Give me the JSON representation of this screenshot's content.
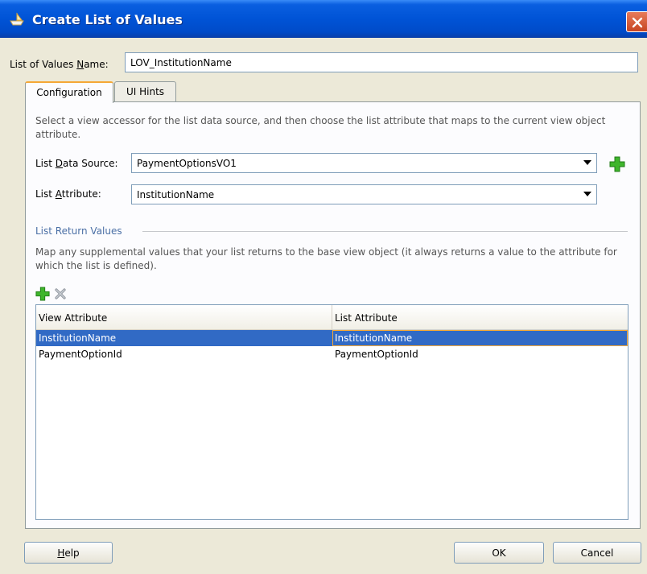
{
  "dialog": {
    "title": "Create List of Values",
    "title_icon": "ship-icon",
    "close_icon": "close-icon"
  },
  "lov_name": {
    "label_pre": "List of Values ",
    "label_mnemonic": "N",
    "label_post": "ame:",
    "value": "LOV_InstitutionName"
  },
  "tabs": [
    {
      "label": "Configuration",
      "selected": true
    },
    {
      "label": "UI Hints",
      "selected": false
    }
  ],
  "configuration": {
    "description": "Select a view accessor for the list data source, and then choose the list attribute that maps to the current view object attribute.",
    "data_source": {
      "label_pre": "List ",
      "label_mnemonic": "D",
      "label_post": "ata Source:",
      "value": "PaymentOptionsVO1",
      "add_icon": "add-icon"
    },
    "list_attribute": {
      "label_pre": "List ",
      "label_mnemonic": "A",
      "label_post": "ttribute:",
      "value": "InstitutionName"
    }
  },
  "return_values": {
    "section_title": "List Return Values",
    "description": "Map any supplemental values that your list returns to the base view object (it always returns a value to the attribute for which the list is defined).",
    "add_icon": "add-icon",
    "remove_icon": "remove-icon",
    "columns": [
      "View Attribute",
      "List Attribute"
    ],
    "rows": [
      {
        "view_attribute": "InstitutionName",
        "list_attribute": "InstitutionName",
        "selected": true
      },
      {
        "view_attribute": "PaymentOptionId",
        "list_attribute": "PaymentOptionId",
        "selected": false
      }
    ]
  },
  "buttons": {
    "help_mnemonic": "H",
    "help_rest": "elp",
    "ok": "OK",
    "cancel": "Cancel"
  },
  "colors": {
    "titlebar": "#0053d6",
    "selection": "#316ac5",
    "focus_border": "#f5a836",
    "section_title": "#4a6fa5"
  }
}
